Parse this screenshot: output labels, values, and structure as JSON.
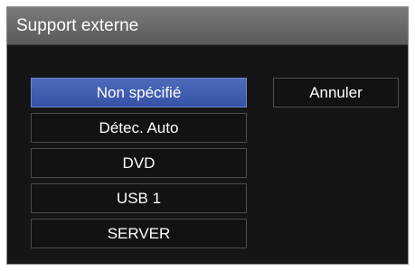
{
  "dialog": {
    "title": "Support externe"
  },
  "options": [
    {
      "label": "Non spécifié",
      "selected": true
    },
    {
      "label": "Détec. Auto",
      "selected": false
    },
    {
      "label": "DVD",
      "selected": false
    },
    {
      "label": "USB 1",
      "selected": false
    },
    {
      "label": "SERVER",
      "selected": false
    }
  ],
  "cancel_label": "Annuler",
  "colors": {
    "selected": "#3552a6",
    "background": "#151515",
    "titlebar": "#6a6a6a"
  }
}
